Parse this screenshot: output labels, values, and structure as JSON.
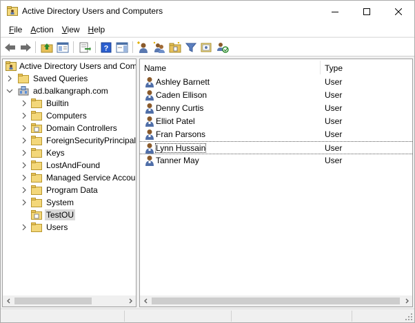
{
  "window": {
    "title": "Active Directory Users and Computers",
    "icon": "ad-users-icon"
  },
  "menu": {
    "items": [
      {
        "ul": "F",
        "rest": "ile"
      },
      {
        "ul": "A",
        "rest": "ction"
      },
      {
        "ul": "V",
        "rest": "iew"
      },
      {
        "ul": "H",
        "rest": "elp"
      }
    ]
  },
  "toolbar": {
    "icons": [
      "back-arrow-icon",
      "forward-arrow-icon",
      "up-folder-icon",
      "show-hide-tree-icon",
      "export-list-icon",
      "help-icon",
      "action-pane-icon",
      "new-user-icon",
      "new-group-icon",
      "new-ou-icon",
      "filter-icon",
      "add-to-group-icon",
      "delegate-control-icon"
    ]
  },
  "tree": {
    "root": "Active Directory Users and Com",
    "saved_queries": "Saved Queries",
    "domain": "ad.balkangraph.com",
    "children": [
      "Builtin",
      "Computers",
      "Domain Controllers",
      "ForeignSecurityPrincipals",
      "Keys",
      "LostAndFound",
      "Managed Service Accour",
      "Program Data",
      "System",
      "TestOU",
      "Users"
    ],
    "selected": "TestOU"
  },
  "list": {
    "columns": {
      "name": "Name",
      "type": "Type"
    },
    "rows": [
      {
        "name": "Ashley Barnett",
        "type": "User"
      },
      {
        "name": "Caden Ellison",
        "type": "User"
      },
      {
        "name": "Denny Curtis",
        "type": "User"
      },
      {
        "name": "Elliot Patel",
        "type": "User"
      },
      {
        "name": "Fran Parsons",
        "type": "User"
      },
      {
        "name": "Lynn Hussain",
        "type": "User"
      },
      {
        "name": "Tanner May",
        "type": "User"
      }
    ],
    "focused_row": "Lynn Hussain"
  },
  "colors": {
    "folder": "#e8c15a",
    "selection": "#d9d9d9",
    "help_blue": "#2b5fd0"
  }
}
